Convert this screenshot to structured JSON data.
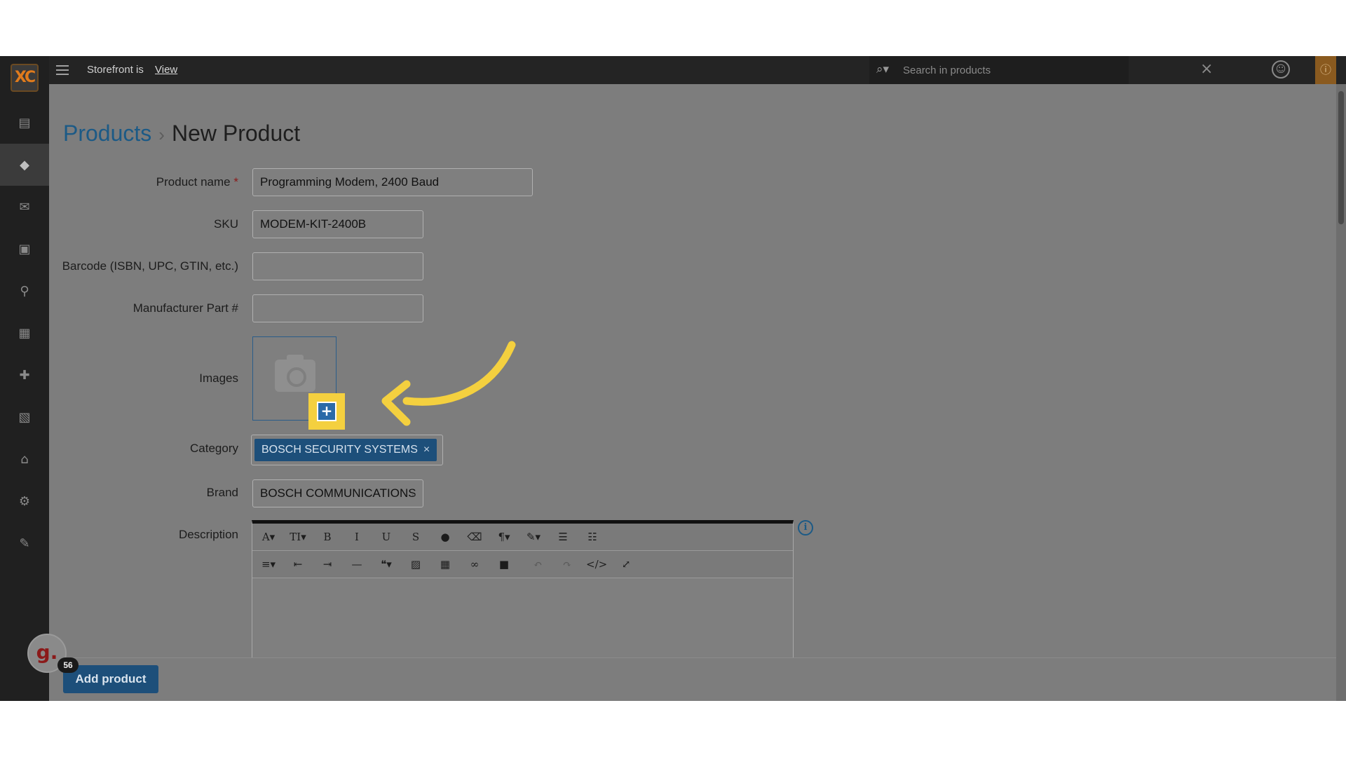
{
  "topbar": {
    "storefront_text": "Storefront is",
    "storefront_link": "View",
    "search_placeholder": "Search in products",
    "search_icon": "search-icon",
    "close_icon": "close-icon",
    "user_icon": "user-icon",
    "info_icon": "info-icon"
  },
  "sidebar": {
    "logo": "XC",
    "items": [
      {
        "icon": "orders-icon",
        "glyph": "▤"
      },
      {
        "icon": "tags-icon",
        "glyph": "◆"
      },
      {
        "icon": "mail-icon",
        "glyph": "✉"
      },
      {
        "icon": "gift-icon",
        "glyph": "▣"
      },
      {
        "icon": "network-icon",
        "glyph": "⚲"
      },
      {
        "icon": "page-icon",
        "glyph": "▦"
      },
      {
        "icon": "puzzle-icon",
        "glyph": "✚"
      },
      {
        "icon": "image-icon",
        "glyph": "▧"
      },
      {
        "icon": "store-icon",
        "glyph": "⌂"
      },
      {
        "icon": "gear-icon",
        "glyph": "⚙"
      },
      {
        "icon": "wrench-icon",
        "glyph": "✎"
      }
    ],
    "active_index": 1
  },
  "breadcrumb": {
    "parent": "Products",
    "separator": "›",
    "current": "New Product"
  },
  "form": {
    "product_name_label": "Product name",
    "required_mark": "*",
    "product_name_value": "Programming Modem, 2400 Baud",
    "sku_label": "SKU",
    "sku_value": "MODEM-KIT-2400B",
    "barcode_label": "Barcode (ISBN, UPC, GTIN, etc.)",
    "barcode_value": "",
    "mpn_label": "Manufacturer Part #",
    "mpn_value": "",
    "images_label": "Images",
    "add_image_glyph": "+",
    "category_label": "Category",
    "category_tag": "BOSCH SECURITY SYSTEMS",
    "category_remove": "×",
    "brand_label": "Brand",
    "brand_value": "BOSCH COMMUNICATIONS",
    "description_label": "Description"
  },
  "editor": {
    "row1": [
      {
        "name": "font-style-button",
        "glyph": "A▾"
      },
      {
        "name": "font-size-button",
        "glyph": "TI▾"
      },
      {
        "name": "bold-button",
        "glyph": "B"
      },
      {
        "name": "italic-button",
        "glyph": "I"
      },
      {
        "name": "underline-button",
        "glyph": "U"
      },
      {
        "name": "strikethrough-button",
        "glyph": "S"
      },
      {
        "name": "color-button",
        "glyph": "●"
      },
      {
        "name": "clear-format-button",
        "glyph": "⌫"
      },
      {
        "name": "paragraph-button",
        "glyph": "¶▾"
      },
      {
        "name": "style-button",
        "glyph": "✎▾"
      },
      {
        "name": "ordered-list-button",
        "glyph": "☰"
      },
      {
        "name": "unordered-list-button",
        "glyph": "☷"
      }
    ],
    "row2": [
      {
        "name": "align-button",
        "glyph": "≡▾"
      },
      {
        "name": "outdent-button",
        "glyph": "⇤"
      },
      {
        "name": "indent-button",
        "glyph": "⇥"
      },
      {
        "name": "horizontal-rule-button",
        "glyph": "—"
      },
      {
        "name": "quote-button",
        "glyph": "❝▾"
      },
      {
        "name": "insert-image-button",
        "glyph": "▨"
      },
      {
        "name": "insert-table-button",
        "glyph": "▦"
      },
      {
        "name": "link-button",
        "glyph": "∞"
      },
      {
        "name": "video-button",
        "glyph": "■"
      },
      {
        "name": "undo-button",
        "glyph": "↶"
      },
      {
        "name": "redo-button",
        "glyph": "↷"
      },
      {
        "name": "code-view-button",
        "glyph": "</>"
      },
      {
        "name": "fullscreen-button",
        "glyph": "⤢"
      }
    ],
    "info_glyph": "i"
  },
  "footer": {
    "add_product_label": "Add product"
  },
  "widget": {
    "logo_text": "g.",
    "badge_count": "56"
  },
  "colors": {
    "accent": "#1d4f7a",
    "highlight": "#f4d03f",
    "topbar": "#242424"
  }
}
